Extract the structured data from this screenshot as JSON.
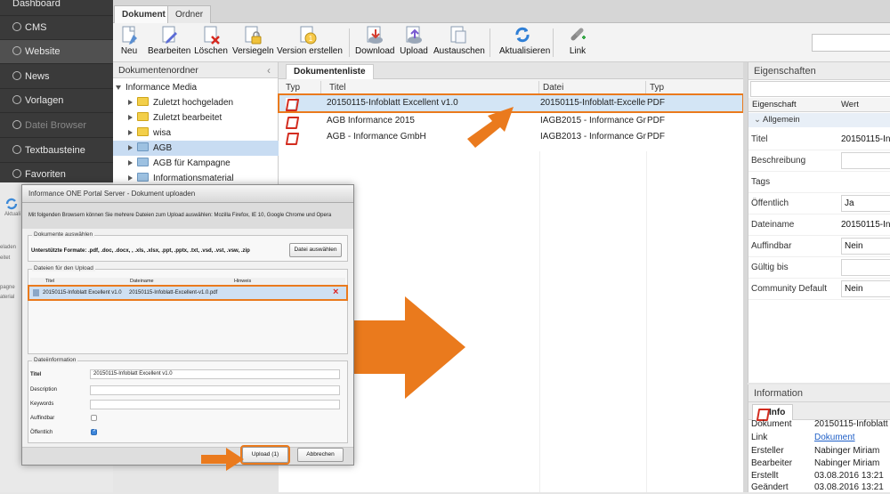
{
  "nav": {
    "items": [
      {
        "label": "Dashboard",
        "icon": "dashboard-icon"
      },
      {
        "label": "CMS",
        "icon": "cms-icon"
      },
      {
        "label": "Website",
        "icon": "globe-icon"
      },
      {
        "label": "News",
        "icon": "rss-icon"
      },
      {
        "label": "Vorlagen",
        "icon": "arrow-icon"
      },
      {
        "label": "Datei Browser",
        "icon": "file-icon"
      },
      {
        "label": "Textbausteine",
        "icon": "text-icon"
      },
      {
        "label": "Favoriten",
        "icon": "star-icon"
      }
    ]
  },
  "tabs": {
    "dokument": "Dokument",
    "ordner": "Ordner"
  },
  "toolbar": {
    "neu": "Neu",
    "bearbeiten": "Bearbeiten",
    "loeschen": "Löschen",
    "versiegeln": "Versiegeln",
    "version": "Version erstellen",
    "download": "Download",
    "upload": "Upload",
    "austauschen": "Austauschen",
    "aktualisieren": "Aktualisieren",
    "link": "Link"
  },
  "folders": {
    "title": "Dokumentenordner",
    "items": [
      {
        "label": "Informance Media"
      },
      {
        "label": "Zuletzt hochgeladen"
      },
      {
        "label": "Zuletzt bearbeitet"
      },
      {
        "label": "wisa"
      },
      {
        "label": "AGB"
      },
      {
        "label": "AGB für Kampagne"
      },
      {
        "label": "Informationsmaterial"
      }
    ]
  },
  "doclist": {
    "tab": "Dokumentenliste",
    "columns": {
      "typ": "Typ",
      "titel": "Titel",
      "datei": "Datei",
      "typ2": "Typ"
    },
    "rows": [
      {
        "titel": "20150115-Infoblatt Excellent v1.0",
        "datei": "20150115-Infoblatt-Excellent-v",
        "typ": "PDF"
      },
      {
        "titel": "AGB Informance 2015",
        "datei": "IAGB2015 - Informance GmbH",
        "typ": "PDF"
      },
      {
        "titel": "AGB - Informance GmbH",
        "datei": "IAGB2013 - Informance GmbH",
        "typ": "PDF"
      }
    ]
  },
  "props": {
    "title": "Eigenschaften",
    "col_key": "Eigenschaft",
    "col_val": "Wert",
    "group": "Allgemein",
    "rows": [
      {
        "k": "Titel",
        "v": "20150115-Infoblatt"
      },
      {
        "k": "Beschreibung",
        "v": ""
      },
      {
        "k": "Tags",
        "v": ""
      },
      {
        "k": "Öffentlich",
        "v": "Ja"
      },
      {
        "k": "Dateiname",
        "v": "20150115-Infoblatt"
      },
      {
        "k": "Auffindbar",
        "v": "Nein"
      },
      {
        "k": "Gültig bis",
        "v": ""
      },
      {
        "k": "Community Default",
        "v": "Nein"
      }
    ]
  },
  "info": {
    "title": "Information",
    "tab": "Info",
    "rows": [
      {
        "k": "Dokument",
        "v": "20150115-Infoblatt Exce"
      },
      {
        "k": "Link",
        "v": "Dokument"
      },
      {
        "k": "Ersteller",
        "v": "Nabinger Miriam"
      },
      {
        "k": "Bearbeiter",
        "v": "Nabinger Miriam"
      },
      {
        "k": "Erstellt",
        "v": "03.08.2016 13:21"
      },
      {
        "k": "Geändert",
        "v": "03.08.2016 13:21"
      }
    ]
  },
  "dialog": {
    "title": "Informance ONE Portal Server - Dokument uploaden",
    "note": "Mit folgenden Browsern können Sie mehrere Dateien zum Upload auswählen: Mozilla Firefox, IE 10, Google Chrome und Opera",
    "fs1_legend": "Dokumente auswählen",
    "formats": "Unterstützte Formate: .pdf, .doc, .docx, , .xls, .xlsx, .ppt, .pptx, .txt, .vsd, .vst, .vsw, .zip",
    "choose_btn": "Datei auswählen",
    "fs2_legend": "Dateien für den Upload",
    "cols": {
      "titel": "Titel",
      "dateiname": "Dateiname",
      "hinweis": "Hinweis"
    },
    "file": {
      "titel": "20150115-Infoblatt Excellent v1.0",
      "dateiname": "20150115-Infoblatt-Excellent-v1.0.pdf"
    },
    "fs3_legend": "Dateiinformation",
    "fields": {
      "titel_label": "Titel",
      "titel_value": "20150115-Infoblatt Excellent v1.0",
      "desc_label": "Description",
      "kw_label": "Keywords",
      "auff_label": "Auffindbar",
      "oeff_label": "Öffentlich"
    },
    "upload_btn": "Upload (1)",
    "cancel_btn": "Abbrechen"
  },
  "behind": {
    "aktualisieren": "Aktuali",
    "side": [
      "eladen",
      "eitet",
      "pagne",
      "aterial"
    ]
  },
  "colors": {
    "accent": "#ea7a1d",
    "nav_bg": "#3a3a3a",
    "selection": "#d3e5f5"
  }
}
